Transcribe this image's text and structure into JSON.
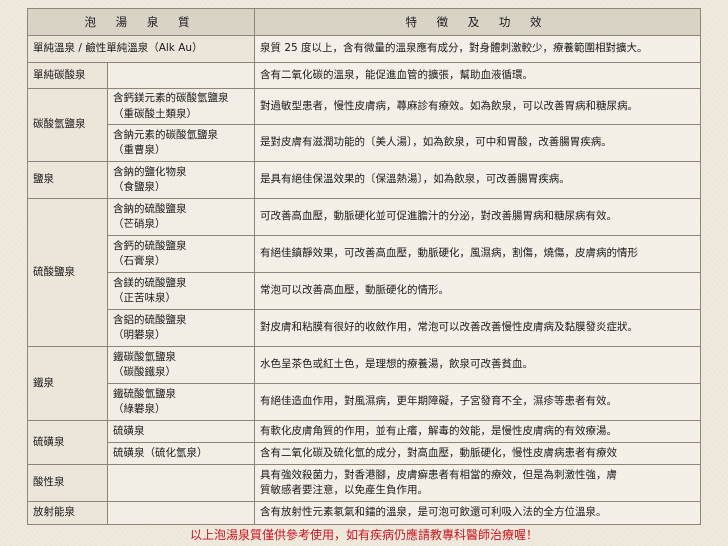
{
  "header": {
    "col_quality": "泡 湯 泉 質",
    "col_features": "特 徵 及 功 效"
  },
  "rows": {
    "simple_hot": {
      "category": "單純溫泉 / 鹼性單純溫泉（Alk Au）",
      "desc": "泉質 25 度以上，含有微量的溫泉應有成分，對身體刺激較少，療養範圍相對擴大。"
    },
    "simple_carbonic": {
      "category": "單純碳酸泉",
      "desc": "含有二氧化碳的溫泉，能促進血管的擴張，幫助血液循環。"
    },
    "bicarbonate": {
      "category": "碳酸氫鹽泉",
      "sub1_line1": "含鈣鎂元素的碳酸氫鹽泉",
      "sub1_line2": "（重碳酸土類泉）",
      "desc1": "對過敏型患者，慢性皮膚病，蕁麻診有療效。如為飲泉，可以改善胃病和糖尿病。",
      "sub2_line1": "含鈉元素的碳酸氫鹽泉",
      "sub2_line2": "（重曹泉）",
      "desc2": "是對皮膚有滋潤功能的〔美人湯〕，如為飲泉，可中和胃酸，改善腸胃疾病。"
    },
    "salt": {
      "category": "鹽泉",
      "sub_line1": "含鈉的鹽化物泉",
      "sub_line2": "（食鹽泉）",
      "desc": "是具有絕佳保溫效果的〔保溫熱湯〕，如為飲泉，可改善腸胃疾病。"
    },
    "sulfate": {
      "category": "硫酸鹽泉",
      "sub1_line1": "含鈉的硫酸鹽泉",
      "sub1_line2": "（芒硝泉）",
      "desc1": "可改善高血壓，動脈硬化並可促進膽汁的分泌，對改善腸胃病和糖尿病有效。",
      "sub2_line1": "含鈣的硫酸鹽泉",
      "sub2_line2": "（石膏泉）",
      "desc2": "有絕佳鎮靜效果，可改善高血壓，動脈硬化，風濕病，割傷，燒傷，皮膚病的情形",
      "sub3_line1": "含鎂的硫酸鹽泉",
      "sub3_line2": "（正苦味泉）",
      "desc3": "常泡可以改善高血壓，動脈硬化的情形。",
      "sub4_line1": "含鋁的硫酸鹽泉",
      "sub4_line2": "（明礬泉）",
      "desc4": "對皮膚和粘膜有很好的收斂作用，常泡可以改善改善慢性皮膚病及黏膜發炎症狀。"
    },
    "iron": {
      "category": "鐵泉",
      "sub1_line1": "鐵碳酸氫鹽泉",
      "sub1_line2": "（碳酸鐵泉）",
      "desc1": "水色呈茶色或紅土色，是理想的療養湯，飲泉可改善貧血。",
      "sub2_line1": "鐵硫酸氫鹽泉",
      "sub2_line2": "（綠礬泉）",
      "desc2": "有絕佳造血作用，對風濕病，更年期障礙，子宮發育不全，濕疹等患者有效。"
    },
    "sulfur": {
      "category": "硫磺泉",
      "sub1": "硫磺泉",
      "desc1": "有軟化皮膚角質的作用，並有止癢，解毒的效能，是慢性皮膚病的有效療湯。",
      "sub2": "硫磺泉（硫化氫泉）",
      "desc2": "含有二氧化碳及硫化氫的成分，對高血壓，動脈硬化，慢性皮膚病患者有療效"
    },
    "acid": {
      "category": "酸性泉",
      "desc_line1": "具有強效殺菌力，對香港腳，皮膚癬患者有相當的療效，但是為刺激性強，膚",
      "desc_line2": "質敏感者要注意，以免產生負作用。"
    },
    "radioactive": {
      "category": "放射能泉",
      "desc": "含有放射性元素氡氣和鐳的溫泉，是可泡可飲還可利吸入法的全方位溫泉。"
    }
  },
  "footer": {
    "note": "以上泡湯泉質僅供參考使用，如有疾病仍應請教專科醫師治療喔！"
  }
}
